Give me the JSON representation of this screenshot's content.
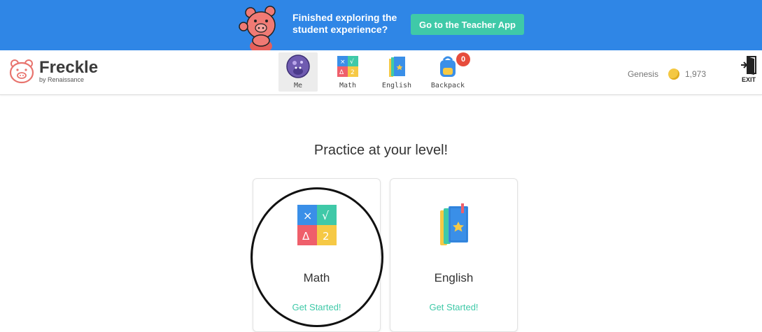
{
  "banner": {
    "message_line1": "Finished exploring the",
    "message_line2": "student experience?",
    "button_label": "Go to the Teacher App",
    "bg_color": "#2f86e6",
    "button_color": "#3fc9a8"
  },
  "logo": {
    "name": "Freckle",
    "tagline": "by Renaissance"
  },
  "nav": {
    "tabs": [
      {
        "label": "Me",
        "icon": "avatar-icon",
        "active": true
      },
      {
        "label": "Math",
        "icon": "math-icon",
        "active": false
      },
      {
        "label": "English",
        "icon": "book-icon",
        "active": false
      },
      {
        "label": "Backpack",
        "icon": "backpack-icon",
        "active": false,
        "badge": "0"
      }
    ]
  },
  "user": {
    "name": "Genesis",
    "coins": "1,973",
    "exit_label": "EXIT"
  },
  "main": {
    "headline": "Practice at your level!",
    "cards": [
      {
        "title": "Math",
        "cta": "Get Started!",
        "icon": "math-icon"
      },
      {
        "title": "English",
        "cta": "Get Started!",
        "icon": "book-icon"
      }
    ]
  },
  "accent_color": "#3fc9a8"
}
